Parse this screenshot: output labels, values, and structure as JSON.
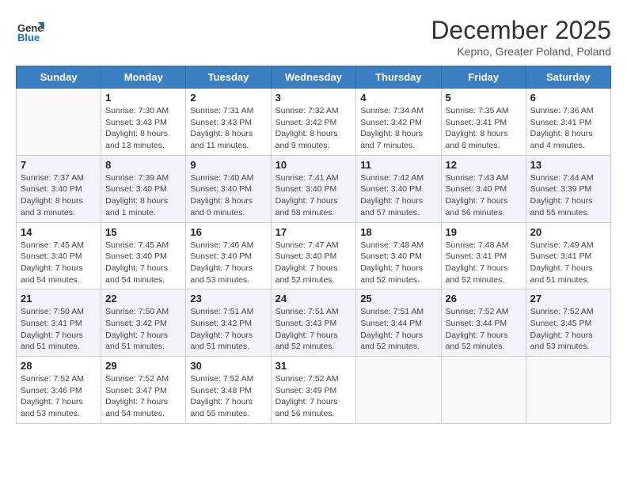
{
  "logo": {
    "general": "General",
    "blue": "Blue"
  },
  "header": {
    "month": "December 2025",
    "location": "Kepno, Greater Poland, Poland"
  },
  "weekdays": [
    "Sunday",
    "Monday",
    "Tuesday",
    "Wednesday",
    "Thursday",
    "Friday",
    "Saturday"
  ],
  "weeks": [
    [
      {
        "day": "",
        "info": ""
      },
      {
        "day": "1",
        "info": "Sunrise: 7:30 AM\nSunset: 3:43 PM\nDaylight: 8 hours\nand 13 minutes."
      },
      {
        "day": "2",
        "info": "Sunrise: 7:31 AM\nSunset: 3:43 PM\nDaylight: 8 hours\nand 11 minutes."
      },
      {
        "day": "3",
        "info": "Sunrise: 7:32 AM\nSunset: 3:42 PM\nDaylight: 8 hours\nand 9 minutes."
      },
      {
        "day": "4",
        "info": "Sunrise: 7:34 AM\nSunset: 3:42 PM\nDaylight: 8 hours\nand 7 minutes."
      },
      {
        "day": "5",
        "info": "Sunrise: 7:35 AM\nSunset: 3:41 PM\nDaylight: 8 hours\nand 6 minutes."
      },
      {
        "day": "6",
        "info": "Sunrise: 7:36 AM\nSunset: 3:41 PM\nDaylight: 8 hours\nand 4 minutes."
      }
    ],
    [
      {
        "day": "7",
        "info": "Sunrise: 7:37 AM\nSunset: 3:40 PM\nDaylight: 8 hours\nand 3 minutes."
      },
      {
        "day": "8",
        "info": "Sunrise: 7:39 AM\nSunset: 3:40 PM\nDaylight: 8 hours\nand 1 minute."
      },
      {
        "day": "9",
        "info": "Sunrise: 7:40 AM\nSunset: 3:40 PM\nDaylight: 8 hours\nand 0 minutes."
      },
      {
        "day": "10",
        "info": "Sunrise: 7:41 AM\nSunset: 3:40 PM\nDaylight: 7 hours\nand 58 minutes."
      },
      {
        "day": "11",
        "info": "Sunrise: 7:42 AM\nSunset: 3:40 PM\nDaylight: 7 hours\nand 57 minutes."
      },
      {
        "day": "12",
        "info": "Sunrise: 7:43 AM\nSunset: 3:40 PM\nDaylight: 7 hours\nand 56 minutes."
      },
      {
        "day": "13",
        "info": "Sunrise: 7:44 AM\nSunset: 3:39 PM\nDaylight: 7 hours\nand 55 minutes."
      }
    ],
    [
      {
        "day": "14",
        "info": "Sunrise: 7:45 AM\nSunset: 3:40 PM\nDaylight: 7 hours\nand 54 minutes."
      },
      {
        "day": "15",
        "info": "Sunrise: 7:45 AM\nSunset: 3:40 PM\nDaylight: 7 hours\nand 54 minutes."
      },
      {
        "day": "16",
        "info": "Sunrise: 7:46 AM\nSunset: 3:40 PM\nDaylight: 7 hours\nand 53 minutes."
      },
      {
        "day": "17",
        "info": "Sunrise: 7:47 AM\nSunset: 3:40 PM\nDaylight: 7 hours\nand 52 minutes."
      },
      {
        "day": "18",
        "info": "Sunrise: 7:48 AM\nSunset: 3:40 PM\nDaylight: 7 hours\nand 52 minutes."
      },
      {
        "day": "19",
        "info": "Sunrise: 7:48 AM\nSunset: 3:41 PM\nDaylight: 7 hours\nand 52 minutes."
      },
      {
        "day": "20",
        "info": "Sunrise: 7:49 AM\nSunset: 3:41 PM\nDaylight: 7 hours\nand 51 minutes."
      }
    ],
    [
      {
        "day": "21",
        "info": "Sunrise: 7:50 AM\nSunset: 3:41 PM\nDaylight: 7 hours\nand 51 minutes."
      },
      {
        "day": "22",
        "info": "Sunrise: 7:50 AM\nSunset: 3:42 PM\nDaylight: 7 hours\nand 51 minutes."
      },
      {
        "day": "23",
        "info": "Sunrise: 7:51 AM\nSunset: 3:42 PM\nDaylight: 7 hours\nand 51 minutes."
      },
      {
        "day": "24",
        "info": "Sunrise: 7:51 AM\nSunset: 3:43 PM\nDaylight: 7 hours\nand 52 minutes."
      },
      {
        "day": "25",
        "info": "Sunrise: 7:51 AM\nSunset: 3:44 PM\nDaylight: 7 hours\nand 52 minutes."
      },
      {
        "day": "26",
        "info": "Sunrise: 7:52 AM\nSunset: 3:44 PM\nDaylight: 7 hours\nand 52 minutes."
      },
      {
        "day": "27",
        "info": "Sunrise: 7:52 AM\nSunset: 3:45 PM\nDaylight: 7 hours\nand 53 minutes."
      }
    ],
    [
      {
        "day": "28",
        "info": "Sunrise: 7:52 AM\nSunset: 3:46 PM\nDaylight: 7 hours\nand 53 minutes."
      },
      {
        "day": "29",
        "info": "Sunrise: 7:52 AM\nSunset: 3:47 PM\nDaylight: 7 hours\nand 54 minutes."
      },
      {
        "day": "30",
        "info": "Sunrise: 7:52 AM\nSunset: 3:48 PM\nDaylight: 7 hours\nand 55 minutes."
      },
      {
        "day": "31",
        "info": "Sunrise: 7:52 AM\nSunset: 3:49 PM\nDaylight: 7 hours\nand 56 minutes."
      },
      {
        "day": "",
        "info": ""
      },
      {
        "day": "",
        "info": ""
      },
      {
        "day": "",
        "info": ""
      }
    ]
  ]
}
